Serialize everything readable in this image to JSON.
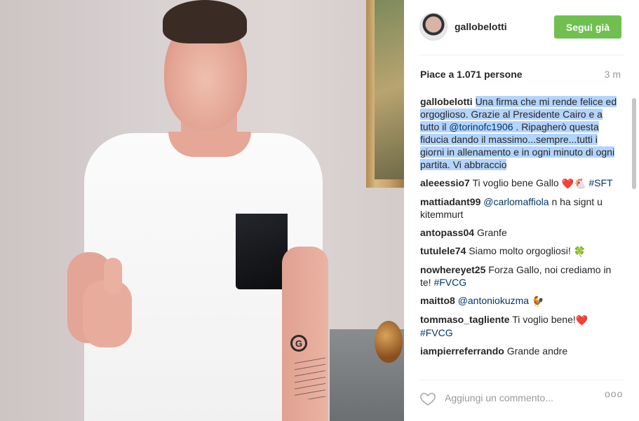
{
  "post": {
    "username": "gallobelotti",
    "follow_label": "Segui già",
    "likes": "Piace a 1.071 persone",
    "time": "3 m",
    "comment_placeholder": "Aggiungi un commento...",
    "more_label": "ooo",
    "accent_color": "#70c050",
    "link_color": "#003569"
  },
  "photo": {
    "tattoo_letter": "G"
  },
  "caption": {
    "user": "gallobelotti",
    "text_1": "Una firma che mi rende felice ed orgoglioso. Grazie al Presidente Cairo e a tutto il ",
    "mention": "@torinofc1906",
    "text_2": " . Ripagherò questa fiducia dando il massimo...sempre...tutti i giorni in allenamento e in ogni minuto di ogni partita. Vi abbraccio"
  },
  "comments": [
    {
      "user": "aleeessio7",
      "text": "Ti voglio bene Gallo ",
      "emoji": "❤️🐔",
      "tag": "#SFT"
    },
    {
      "user": "mattiadant99",
      "mention": "@carlomaffiola",
      "text": " n ha signt u kitemmurt"
    },
    {
      "user": "antopass04",
      "text": "Granfe"
    },
    {
      "user": "tutulele74",
      "text": "Siamo molto orgogliosi! ",
      "emoji": "🍀"
    },
    {
      "user": "nowhereyet25",
      "text": "Forza Gallo, noi crediamo in te! ",
      "tag": "#FVCG"
    },
    {
      "user": "maitto8",
      "mention": "@antoniokuzma",
      "emoji": "🐓"
    },
    {
      "user": "tommaso_tagliente",
      "text": "Ti voglio bene!",
      "emoji": "❤️",
      "tag": "#FVCG"
    },
    {
      "user": "iampierreferrando",
      "text": "Grande andre"
    }
  ]
}
